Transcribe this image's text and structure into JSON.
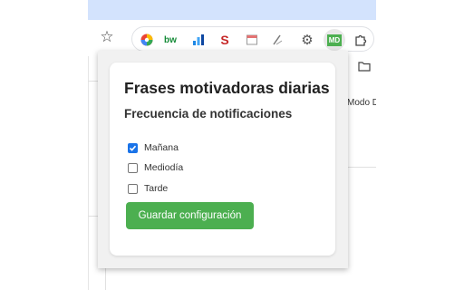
{
  "popup": {
    "title": "Frases motivadoras diarias",
    "subtitle": "Frecuencia de notificaciones",
    "options": [
      {
        "label": "Mañana",
        "checked": true
      },
      {
        "label": "Mediodía",
        "checked": false
      },
      {
        "label": "Tarde",
        "checked": false
      }
    ],
    "save_label": "Guardar configuración"
  },
  "toolbar": {
    "star_icon": "star-icon",
    "extensions": [
      {
        "name": "chrome-color-icon"
      },
      {
        "name": "bw-icon",
        "text": "bw"
      },
      {
        "name": "blue-chart-icon"
      },
      {
        "name": "red-s-icon",
        "text": "S"
      },
      {
        "name": "notepad-icon"
      },
      {
        "name": "pen-icon"
      },
      {
        "name": "gear-icon"
      },
      {
        "name": "md-extension-icon",
        "text": "MD"
      },
      {
        "name": "puzzle-icon"
      }
    ]
  },
  "page": {
    "side_text": "Modo D"
  },
  "colors": {
    "accent_green": "#4caf50",
    "checkbox_blue": "#1a73e8",
    "titlebar": "#d3e3fd"
  }
}
